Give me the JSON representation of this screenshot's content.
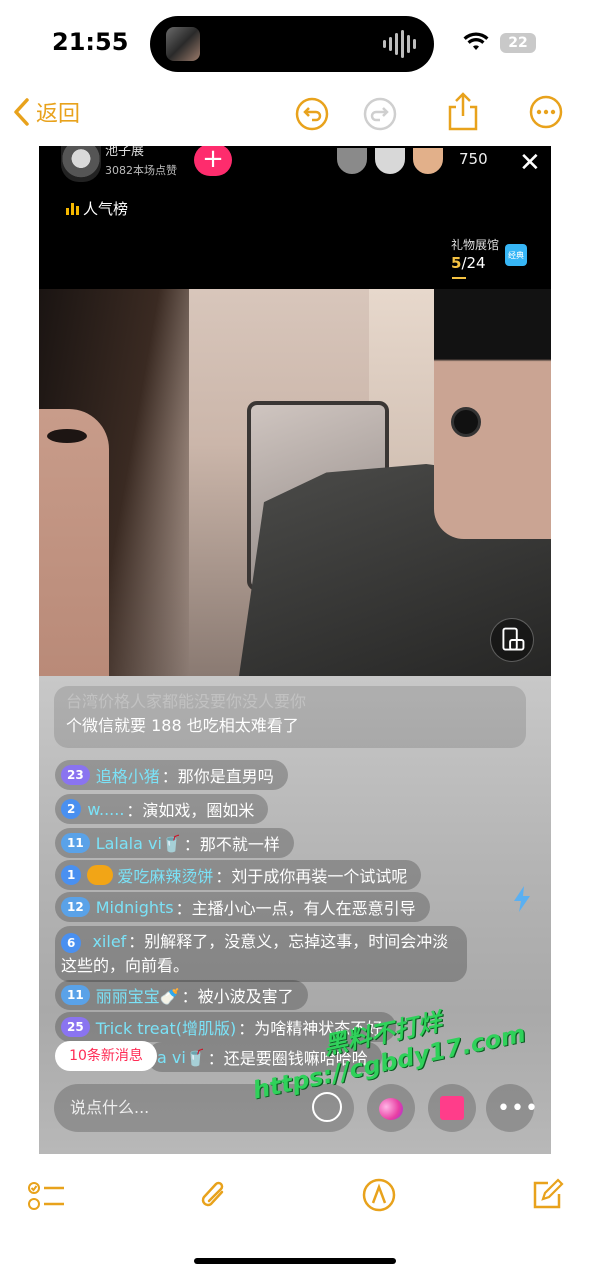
{
  "status_bar": {
    "time": "21:55",
    "battery": "22"
  },
  "app_bar": {
    "back_label": "返回"
  },
  "live": {
    "host_name": "池子展",
    "host_likes": "3082本场点赞",
    "viewer_count": "750",
    "rank_label": "人气榜",
    "gift_gallery_label": "礼物展馆",
    "gift_progress_current": "5",
    "gift_progress_total": "/24",
    "gift_badge": "经典"
  },
  "chat": {
    "faded_line_1": "台湾价格人家都能没要你没人要你",
    "faded_line_2": "个微信就要 188 也吃相太难看了",
    "messages": [
      {
        "level": "23",
        "user": "追格小猪",
        "text": "：那你是直男吗"
      },
      {
        "level": "2",
        "user": "w.....",
        "text": "：演如戏，圈如米"
      },
      {
        "level": "11",
        "user": "Lalala vi🥤",
        "text": "：那不就一样"
      },
      {
        "level": "1",
        "user": "爱吃麻辣烫饼",
        "text": "：刘于成你再装一个试试呢"
      },
      {
        "level": "12",
        "user": "Midnights",
        "text": "：主播小心一点，有人在恶意引导"
      },
      {
        "level": "6",
        "user": "xilef",
        "text": "：别解释了，没意义，忘掉这事，时间会冲淡这些的，向前看。"
      },
      {
        "level": "11",
        "user": "丽丽宝宝🍼",
        "text": "：被小波及害了"
      },
      {
        "level": "25",
        "user": "Trick treat(增肌版)",
        "text": "：为啥精神状态不好"
      },
      {
        "level": "",
        "user": "a vi🥤",
        "text": "：还是要圈钱嘛哈哈哈"
      }
    ],
    "new_messages": "10条新消息",
    "input_placeholder": "说点什么..."
  },
  "watermark": {
    "line1": "黑料不打烊",
    "line2": "https://cgbdy17.com"
  },
  "colors": {
    "accent": "#e8a21c",
    "follow": "#fe2c6d",
    "username": "#7be2f7",
    "watermark": "#2fd15a"
  }
}
